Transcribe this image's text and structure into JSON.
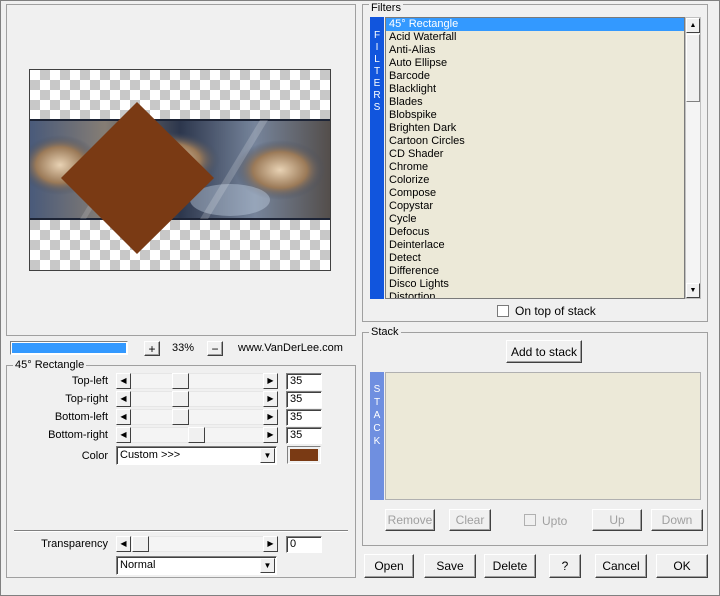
{
  "preview": {
    "zoom": "33%",
    "website": "www.VanDerLee.com",
    "zoom_in_label": "+",
    "zoom_out_label": "−",
    "shape_color": "#7a3a14"
  },
  "filters": {
    "group_label": "Filters",
    "side_text": [
      "F",
      "I",
      "L",
      "T",
      "E",
      "R",
      "S"
    ],
    "items": [
      "45° Rectangle",
      "Acid Waterfall",
      "Anti-Alias",
      "Auto Ellipse",
      "Barcode",
      "Blacklight",
      "Blades",
      "Blobspike",
      "Brighten Dark",
      "Cartoon Circles",
      "CD Shader",
      "Chrome",
      "Colorize",
      "Compose",
      "Copystar",
      "Cycle",
      "Defocus",
      "Deinterlace",
      "Detect",
      "Difference",
      "Disco Lights",
      "Distortion"
    ],
    "selected_index": 0,
    "on_top_label": "On top of stack"
  },
  "params": {
    "group_label": "45° Rectangle",
    "sliders": [
      {
        "label": "Top-left",
        "value": "35"
      },
      {
        "label": "Top-right",
        "value": "35"
      },
      {
        "label": "Bottom-left",
        "value": "35"
      },
      {
        "label": "Bottom-right",
        "value": "35"
      }
    ],
    "color_label": "Color",
    "color_value": "Custom >>>",
    "color_swatch": "#7a3a14",
    "transparency_label": "Transparency",
    "transparency_value": "0",
    "blend_mode": "Normal"
  },
  "stack": {
    "group_label": "Stack",
    "add_label": "Add to stack",
    "side_text": [
      "S",
      "T",
      "A",
      "C",
      "K"
    ],
    "remove_label": "Remove",
    "clear_label": "Clear",
    "upto_label": "Upto",
    "up_label": "Up",
    "down_label": "Down"
  },
  "footer": {
    "open_label": "Open",
    "save_label": "Save",
    "delete_label": "Delete",
    "help_label": "?",
    "cancel_label": "Cancel",
    "ok_label": "OK"
  }
}
